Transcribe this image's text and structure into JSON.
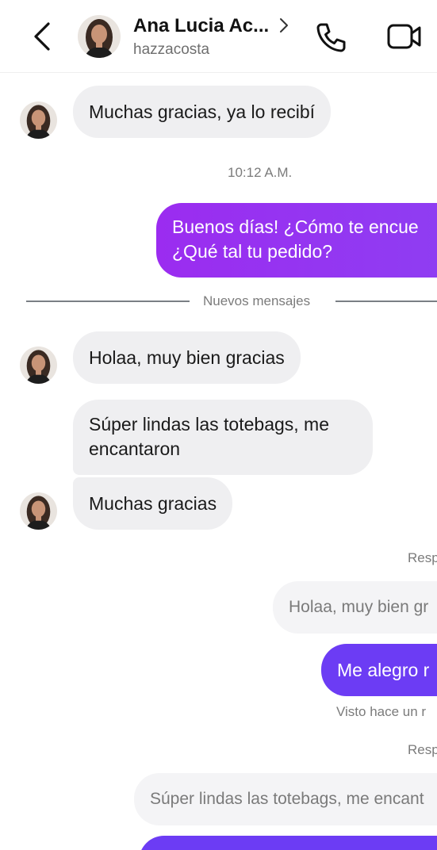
{
  "header": {
    "contact_name": "Ana Lucia Ac...",
    "username": "hazzacosta",
    "icons": {
      "back": "chevron-left-icon",
      "profile_chevron": "chevron-right-icon",
      "call": "phone-icon",
      "video": "video-camera-icon"
    }
  },
  "messages": {
    "m1": "Muchas gracias, ya lo recibí",
    "timestamp": "10:12 A.M.",
    "m2_line1": "Buenos días! ¿Cómo te encue",
    "m2_line2": "¿Qué tal tu pedido?",
    "divider": "Nuevos mensajes",
    "m3": "Holaa, muy bien gracias",
    "m4_line1": "Súper lindas las totebags, me",
    "m4_line2": "encantaron",
    "m5": "Muchas gracias",
    "reply_label_1": "Resp",
    "reply_quote_1": "Holaa, muy bien gr",
    "m6": "Me alegro r",
    "seen": "Visto hace un r",
    "reply_label_2": "Resp",
    "reply_quote_2": "Súper lindas las totebags, me encant"
  },
  "colors": {
    "incoming_bubble": "#efeff1",
    "outgoing_purple": "#9b2cf0",
    "outgoing_blue": "#6c3cf4",
    "reply_quote": "#f4f4f6"
  }
}
